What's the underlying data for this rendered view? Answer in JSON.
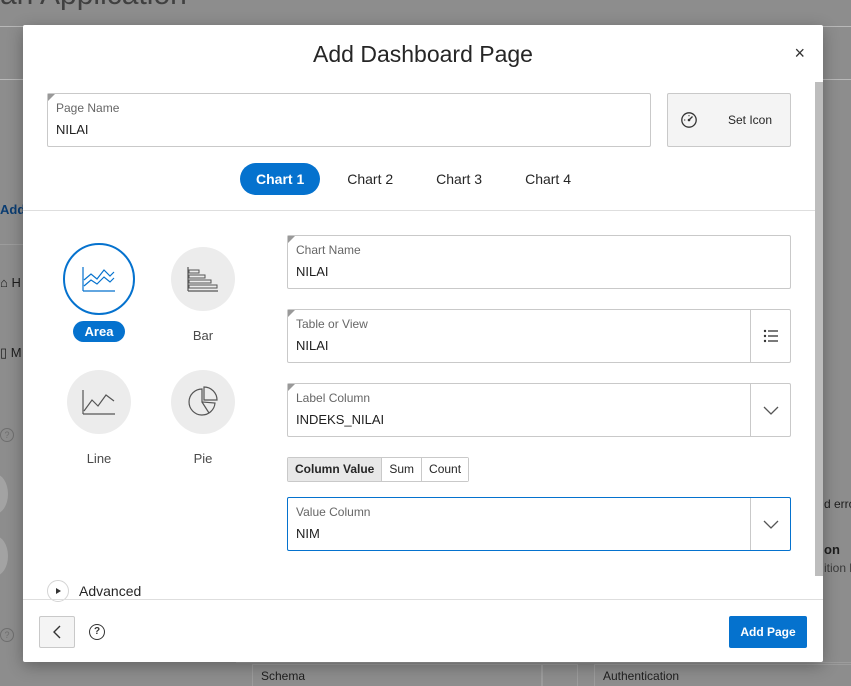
{
  "background": {
    "title": "an Application",
    "left_add": "Add",
    "left_h": "H",
    "left_m": "M",
    "right_err": "d erro",
    "right_on": "on",
    "right_lo": "ition lo",
    "schema_label": "Schema",
    "auth_label": "Authentication"
  },
  "dialog": {
    "title": "Add Dashboard Page",
    "close": "×",
    "page_name": {
      "label": "Page Name",
      "value": "NILAI"
    },
    "set_icon": {
      "label": "Set Icon",
      "icon": "gauge-icon"
    },
    "tabs": [
      {
        "label": "Chart 1",
        "active": true
      },
      {
        "label": "Chart 2",
        "active": false
      },
      {
        "label": "Chart 3",
        "active": false
      },
      {
        "label": "Chart 4",
        "active": false
      }
    ],
    "chart_types": [
      {
        "label": "Area",
        "icon": "area-chart-icon",
        "active": true
      },
      {
        "label": "Bar",
        "icon": "bar-chart-icon",
        "active": false
      },
      {
        "label": "Line",
        "icon": "line-chart-icon",
        "active": false
      },
      {
        "label": "Pie",
        "icon": "pie-chart-icon",
        "active": false
      }
    ],
    "chart_name": {
      "label": "Chart Name",
      "value": "NILAI"
    },
    "table_or_view": {
      "label": "Table or View",
      "value": "NILAI",
      "icon": "list-icon"
    },
    "label_column": {
      "label": "Label Column",
      "value": "INDEKS_NILAI",
      "icon": "chevron-down-icon"
    },
    "aggregation": [
      {
        "label": "Column Value",
        "active": true
      },
      {
        "label": "Sum",
        "active": false
      },
      {
        "label": "Count",
        "active": false
      }
    ],
    "value_column": {
      "label": "Value Column",
      "value": "NIM",
      "icon": "chevron-down-icon"
    },
    "advanced": "Advanced",
    "footer": {
      "help": "?",
      "add_page": "Add Page"
    }
  },
  "colors": {
    "accent": "#0572ce",
    "overlay": "#8d8d8d"
  }
}
